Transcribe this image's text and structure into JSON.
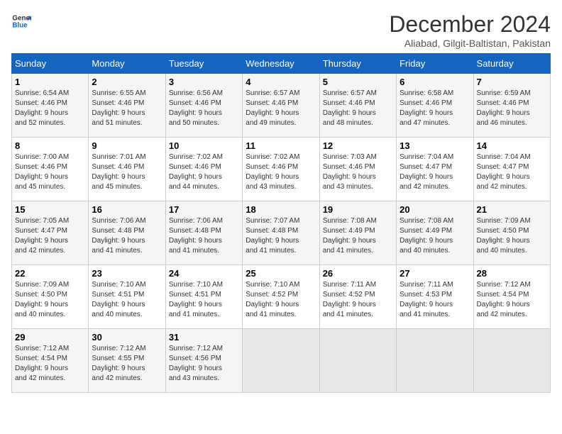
{
  "header": {
    "logo_line1": "General",
    "logo_line2": "Blue",
    "month_title": "December 2024",
    "subtitle": "Aliabad, Gilgit-Baltistan, Pakistan"
  },
  "days_of_week": [
    "Sunday",
    "Monday",
    "Tuesday",
    "Wednesday",
    "Thursday",
    "Friday",
    "Saturday"
  ],
  "weeks": [
    [
      {
        "day": "1",
        "info": "Sunrise: 6:54 AM\nSunset: 4:46 PM\nDaylight: 9 hours\nand 52 minutes."
      },
      {
        "day": "2",
        "info": "Sunrise: 6:55 AM\nSunset: 4:46 PM\nDaylight: 9 hours\nand 51 minutes."
      },
      {
        "day": "3",
        "info": "Sunrise: 6:56 AM\nSunset: 4:46 PM\nDaylight: 9 hours\nand 50 minutes."
      },
      {
        "day": "4",
        "info": "Sunrise: 6:57 AM\nSunset: 4:46 PM\nDaylight: 9 hours\nand 49 minutes."
      },
      {
        "day": "5",
        "info": "Sunrise: 6:57 AM\nSunset: 4:46 PM\nDaylight: 9 hours\nand 48 minutes."
      },
      {
        "day": "6",
        "info": "Sunrise: 6:58 AM\nSunset: 4:46 PM\nDaylight: 9 hours\nand 47 minutes."
      },
      {
        "day": "7",
        "info": "Sunrise: 6:59 AM\nSunset: 4:46 PM\nDaylight: 9 hours\nand 46 minutes."
      }
    ],
    [
      {
        "day": "8",
        "info": "Sunrise: 7:00 AM\nSunset: 4:46 PM\nDaylight: 9 hours\nand 45 minutes."
      },
      {
        "day": "9",
        "info": "Sunrise: 7:01 AM\nSunset: 4:46 PM\nDaylight: 9 hours\nand 45 minutes."
      },
      {
        "day": "10",
        "info": "Sunrise: 7:02 AM\nSunset: 4:46 PM\nDaylight: 9 hours\nand 44 minutes."
      },
      {
        "day": "11",
        "info": "Sunrise: 7:02 AM\nSunset: 4:46 PM\nDaylight: 9 hours\nand 43 minutes."
      },
      {
        "day": "12",
        "info": "Sunrise: 7:03 AM\nSunset: 4:46 PM\nDaylight: 9 hours\nand 43 minutes."
      },
      {
        "day": "13",
        "info": "Sunrise: 7:04 AM\nSunset: 4:47 PM\nDaylight: 9 hours\nand 42 minutes."
      },
      {
        "day": "14",
        "info": "Sunrise: 7:04 AM\nSunset: 4:47 PM\nDaylight: 9 hours\nand 42 minutes."
      }
    ],
    [
      {
        "day": "15",
        "info": "Sunrise: 7:05 AM\nSunset: 4:47 PM\nDaylight: 9 hours\nand 42 minutes."
      },
      {
        "day": "16",
        "info": "Sunrise: 7:06 AM\nSunset: 4:48 PM\nDaylight: 9 hours\nand 41 minutes."
      },
      {
        "day": "17",
        "info": "Sunrise: 7:06 AM\nSunset: 4:48 PM\nDaylight: 9 hours\nand 41 minutes."
      },
      {
        "day": "18",
        "info": "Sunrise: 7:07 AM\nSunset: 4:48 PM\nDaylight: 9 hours\nand 41 minutes."
      },
      {
        "day": "19",
        "info": "Sunrise: 7:08 AM\nSunset: 4:49 PM\nDaylight: 9 hours\nand 41 minutes."
      },
      {
        "day": "20",
        "info": "Sunrise: 7:08 AM\nSunset: 4:49 PM\nDaylight: 9 hours\nand 40 minutes."
      },
      {
        "day": "21",
        "info": "Sunrise: 7:09 AM\nSunset: 4:50 PM\nDaylight: 9 hours\nand 40 minutes."
      }
    ],
    [
      {
        "day": "22",
        "info": "Sunrise: 7:09 AM\nSunset: 4:50 PM\nDaylight: 9 hours\nand 40 minutes."
      },
      {
        "day": "23",
        "info": "Sunrise: 7:10 AM\nSunset: 4:51 PM\nDaylight: 9 hours\nand 40 minutes."
      },
      {
        "day": "24",
        "info": "Sunrise: 7:10 AM\nSunset: 4:51 PM\nDaylight: 9 hours\nand 41 minutes."
      },
      {
        "day": "25",
        "info": "Sunrise: 7:10 AM\nSunset: 4:52 PM\nDaylight: 9 hours\nand 41 minutes."
      },
      {
        "day": "26",
        "info": "Sunrise: 7:11 AM\nSunset: 4:52 PM\nDaylight: 9 hours\nand 41 minutes."
      },
      {
        "day": "27",
        "info": "Sunrise: 7:11 AM\nSunset: 4:53 PM\nDaylight: 9 hours\nand 41 minutes."
      },
      {
        "day": "28",
        "info": "Sunrise: 7:12 AM\nSunset: 4:54 PM\nDaylight: 9 hours\nand 42 minutes."
      }
    ],
    [
      {
        "day": "29",
        "info": "Sunrise: 7:12 AM\nSunset: 4:54 PM\nDaylight: 9 hours\nand 42 minutes."
      },
      {
        "day": "30",
        "info": "Sunrise: 7:12 AM\nSunset: 4:55 PM\nDaylight: 9 hours\nand 42 minutes."
      },
      {
        "day": "31",
        "info": "Sunrise: 7:12 AM\nSunset: 4:56 PM\nDaylight: 9 hours\nand 43 minutes."
      },
      {
        "day": "",
        "info": ""
      },
      {
        "day": "",
        "info": ""
      },
      {
        "day": "",
        "info": ""
      },
      {
        "day": "",
        "info": ""
      }
    ]
  ]
}
